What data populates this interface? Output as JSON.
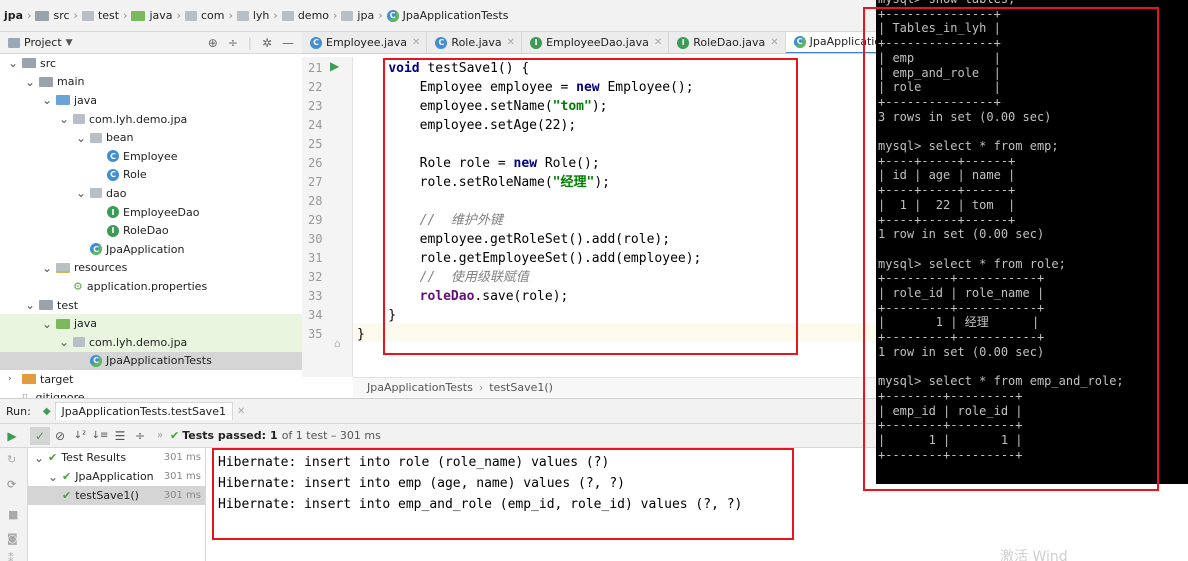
{
  "breadcrumb": [
    "jpa",
    "src",
    "test",
    "java",
    "com",
    "lyh",
    "demo",
    "jpa",
    "JpaApplicationTests"
  ],
  "project_panel": {
    "label": "Project",
    "dropdown_icon": "chevron-down-icon"
  },
  "tree": [
    {
      "label": "src",
      "depth": 0,
      "kind": "folder",
      "open": true
    },
    {
      "label": "main",
      "depth": 1,
      "kind": "folder",
      "open": true
    },
    {
      "label": "java",
      "depth": 2,
      "kind": "folder-blue",
      "open": true
    },
    {
      "label": "com.lyh.demo.jpa",
      "depth": 3,
      "kind": "package",
      "open": true
    },
    {
      "label": "bean",
      "depth": 4,
      "kind": "package",
      "open": true
    },
    {
      "label": "Employee",
      "depth": 5,
      "kind": "class"
    },
    {
      "label": "Role",
      "depth": 5,
      "kind": "class"
    },
    {
      "label": "dao",
      "depth": 4,
      "kind": "package",
      "open": true
    },
    {
      "label": "EmployeeDao",
      "depth": 5,
      "kind": "interface"
    },
    {
      "label": "RoleDao",
      "depth": 5,
      "kind": "interface"
    },
    {
      "label": "JpaApplication",
      "depth": 4,
      "kind": "springclass"
    },
    {
      "label": "resources",
      "depth": 2,
      "kind": "folder-res",
      "open": true
    },
    {
      "label": "application.properties",
      "depth": 3,
      "kind": "props"
    },
    {
      "label": "test",
      "depth": 1,
      "kind": "folder",
      "open": true
    },
    {
      "label": "java",
      "depth": 2,
      "kind": "folder-green",
      "open": true,
      "highlight": true
    },
    {
      "label": "com.lyh.demo.jpa",
      "depth": 3,
      "kind": "package",
      "open": true,
      "highlight": true
    },
    {
      "label": "JpaApplicationTests",
      "depth": 4,
      "kind": "springclass",
      "selected": true
    },
    {
      "label": "target",
      "depth": 0,
      "kind": "folder-orange",
      "open": false
    },
    {
      "label": ".gitignore",
      "depth": 0,
      "kind": "file"
    }
  ],
  "tabs": [
    {
      "label": "Employee.java",
      "kind": "class"
    },
    {
      "label": "Role.java",
      "kind": "class"
    },
    {
      "label": "EmployeeDao.java",
      "kind": "interface"
    },
    {
      "label": "RoleDao.java",
      "kind": "interface"
    },
    {
      "label": "JpaApplication",
      "kind": "springclass",
      "active": true
    }
  ],
  "line_numbers": [
    "21",
    "22",
    "23",
    "24",
    "25",
    "26",
    "27",
    "28",
    "29",
    "30",
    "31",
    "32",
    "33",
    "34",
    "35"
  ],
  "code_lines": [
    [
      {
        "t": "    "
      },
      {
        "t": "void",
        "c": "kw"
      },
      {
        "t": " testSave1() {"
      }
    ],
    [
      {
        "t": "        Employee employee = "
      },
      {
        "t": "new",
        "c": "kw"
      },
      {
        "t": " Employee();"
      }
    ],
    [
      {
        "t": "        employee.setName("
      },
      {
        "t": "\"tom\"",
        "c": "str"
      },
      {
        "t": ");"
      }
    ],
    [
      {
        "t": "        employee.setAge(22);"
      }
    ],
    [
      {
        "t": ""
      }
    ],
    [
      {
        "t": "        Role role = "
      },
      {
        "t": "new",
        "c": "kw"
      },
      {
        "t": " Role();"
      }
    ],
    [
      {
        "t": "        role.setRoleName("
      },
      {
        "t": "\"经理\"",
        "c": "str"
      },
      {
        "t": ");"
      }
    ],
    [
      {
        "t": ""
      }
    ],
    [
      {
        "t": "        "
      },
      {
        "t": "//  维护外键",
        "c": "cmt"
      }
    ],
    [
      {
        "t": "        employee.getRoleSet().add(role);"
      }
    ],
    [
      {
        "t": "        role.getEmployeeSet().add(employee);"
      }
    ],
    [
      {
        "t": "        "
      },
      {
        "t": "//  使用级联赋值",
        "c": "cmt"
      }
    ],
    [
      {
        "t": "        "
      },
      {
        "t": "roleDao",
        "c": "fld"
      },
      {
        "t": ".save(role);"
      }
    ],
    [
      {
        "t": "    }"
      }
    ],
    [
      {
        "t": "}"
      }
    ]
  ],
  "code_breadcrumb": [
    "JpaApplicationTests",
    "testSave1()"
  ],
  "run": {
    "label": "Run:",
    "config": "JpaApplicationTests.testSave1",
    "status_prefix": "Tests passed:",
    "status_count": "1",
    "status_rest": "of 1 test – 301 ms",
    "results": [
      {
        "label": "Test Results",
        "ms": "301 ms",
        "depth": 0
      },
      {
        "label": "JpaApplication",
        "ms": "301 ms",
        "depth": 1
      },
      {
        "label": "testSave1()",
        "ms": "301 ms",
        "depth": 2
      }
    ],
    "console": [
      "Hibernate: insert into role (role_name) values (?)",
      "Hibernate: insert into emp (age, name) values (?, ?)",
      "Hibernate: insert into emp_and_role (emp_id, role_id) values (?, ?)"
    ]
  },
  "terminal": [
    "mysql> show tables;",
    "+---------------+",
    "| Tables_in_lyh |",
    "+---------------+",
    "| emp           |",
    "| emp_and_role  |",
    "| role          |",
    "+---------------+",
    "3 rows in set (0.00 sec)",
    "",
    "mysql> select * from emp;",
    "+----+-----+------+",
    "| id | age | name |",
    "+----+-----+------+",
    "|  1 |  22 | tom  |",
    "+----+-----+------+",
    "1 row in set (0.00 sec)",
    "",
    "mysql> select * from role;",
    "+---------+-----------+",
    "| role_id | role_name |",
    "+---------+-----------+",
    "|       1 | 经理      |",
    "+---------+-----------+",
    "1 row in set (0.00 sec)",
    "",
    "mysql> select * from emp_and_role;",
    "+--------+---------+",
    "| emp_id | role_id |",
    "+--------+---------+",
    "|      1 |       1 |",
    "+--------+---------+"
  ],
  "watermark": "激活 Wind",
  "colors": {
    "highlight": "#e8141e",
    "pass": "#4a9c3b",
    "class_icon": "#3f8fd2",
    "interface_icon": "#3d9a57",
    "selected_row": "#d5d5d5",
    "test_bg": "#eaf5e0"
  }
}
